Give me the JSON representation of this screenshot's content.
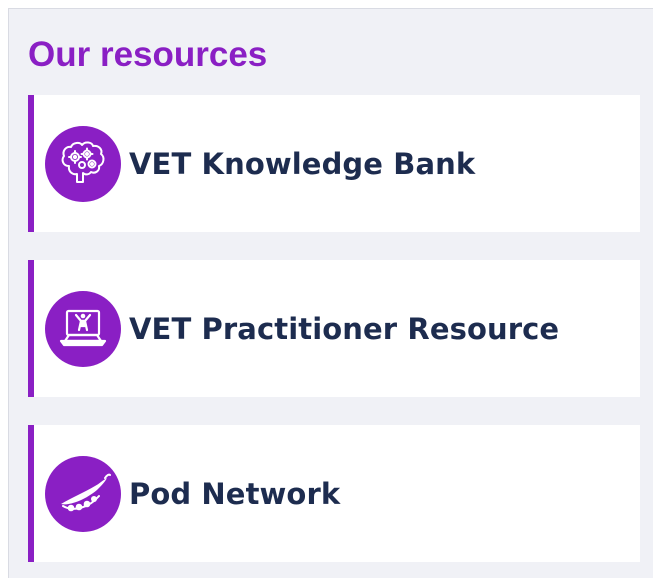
{
  "panel": {
    "title": "Our resources"
  },
  "resources": [
    {
      "label": "VET Knowledge Bank",
      "icon": "brain-gears-icon"
    },
    {
      "label": "VET Practitioner Resource",
      "icon": "laptop-person-icon"
    },
    {
      "label": "Pod Network",
      "icon": "pea-pod-icon"
    }
  ],
  "colors": {
    "accent": "#8a1fc4",
    "text": "#1d2c4f",
    "panel_bg": "#f0f1f6",
    "card_bg": "#ffffff"
  }
}
